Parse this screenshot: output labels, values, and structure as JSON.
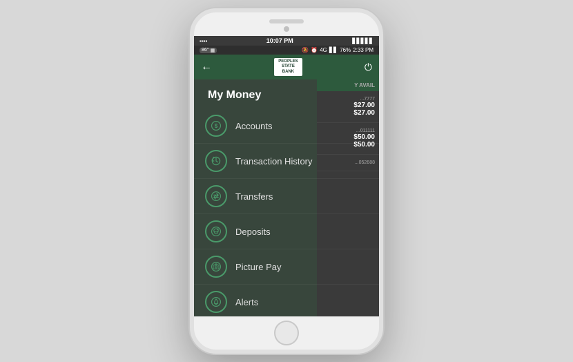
{
  "phone": {
    "status_bar_top": {
      "time": "10:07 PM",
      "battery": "||||",
      "signal": "||||"
    },
    "status_bar_second": {
      "temp": "86°",
      "map_icon": "🗺",
      "time2": "2:33 PM",
      "battery_pct": "76%",
      "signal_icons": "📶"
    }
  },
  "header": {
    "bank_name_line1": "PEOPLES",
    "bank_name_line2": "STATE",
    "bank_name_line3": "BANK",
    "back_label": "←",
    "power_label": "⏻"
  },
  "menu": {
    "title": "My Money",
    "items": [
      {
        "id": "accounts",
        "label": "Accounts",
        "icon": "dollar"
      },
      {
        "id": "transaction-history",
        "label": "Transaction History",
        "icon": "clock"
      },
      {
        "id": "transfers",
        "label": "Transfers",
        "icon": "transfer"
      },
      {
        "id": "deposits",
        "label": "Deposits",
        "icon": "piggy"
      },
      {
        "id": "picture-pay",
        "label": "Picture Pay",
        "icon": "camera"
      },
      {
        "id": "alerts",
        "label": "Alerts",
        "icon": "bell"
      }
    ]
  },
  "right_panel": {
    "header": "Y AVAIL",
    "accounts": [
      {
        "num": "...7777",
        "amount1": "$27.00",
        "amount2": "$27.00"
      },
      {
        "num": "...011111",
        "amount1": "$50.00",
        "amount2": "$50.00"
      },
      {
        "num": "...052688",
        "amount1": "",
        "amount2": ""
      }
    ]
  }
}
